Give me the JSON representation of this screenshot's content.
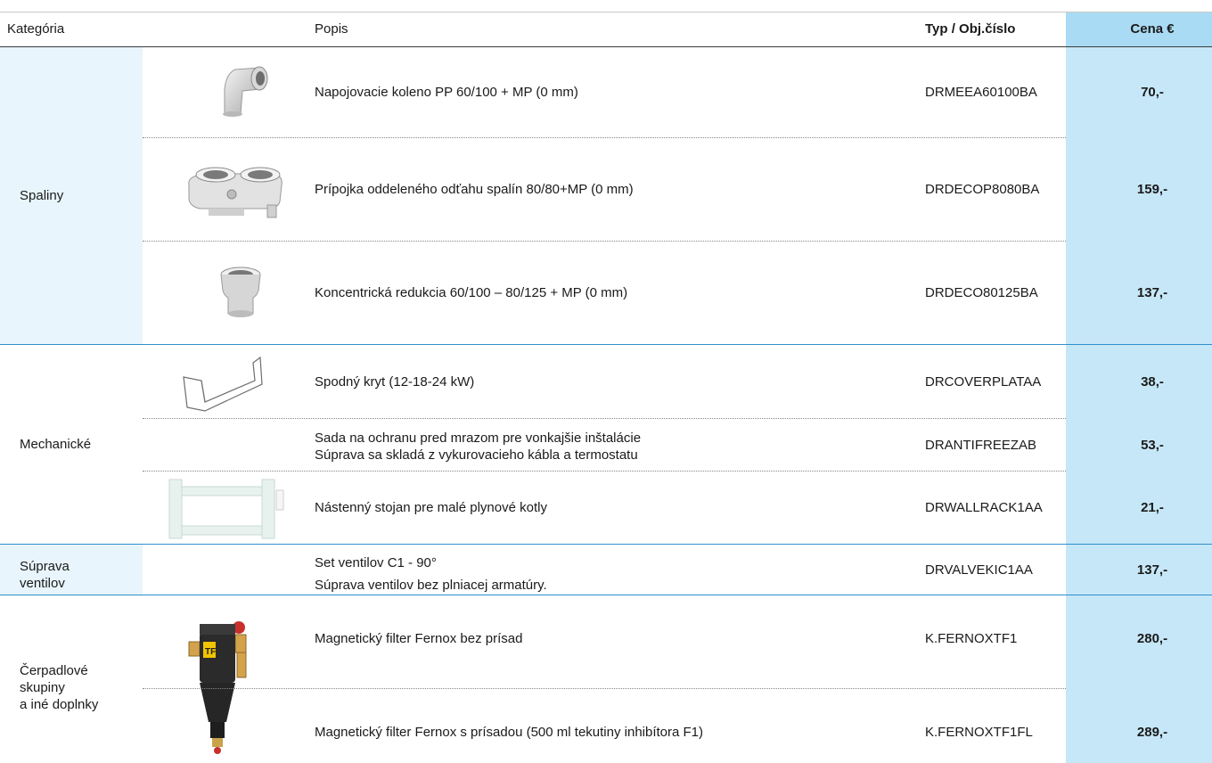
{
  "header": {
    "category": "Kategória",
    "description": "Popis",
    "code": "Typ / Obj.číslo",
    "price": "Cena €"
  },
  "groups": [
    {
      "category": "Spaliny",
      "items": [
        {
          "description": "Napojovacie koleno PP 60/100 + MP (0 mm)",
          "code": "DRMEEA60100BA",
          "price": "70,-",
          "image_icon": "elbow-pipe-icon"
        },
        {
          "description": "Prípojka oddeleného odťahu spalín 80/80+MP (0 mm)",
          "code": "DRDECOP8080BA",
          "price": "159,-",
          "image_icon": "twin-flue-adapter-icon"
        },
        {
          "description": "Koncentrická redukcia 60/100 – 80/125 + MP (0 mm)",
          "code": "DRDECO80125BA",
          "price": "137,-",
          "image_icon": "concentric-reducer-icon"
        }
      ]
    },
    {
      "category": "Mechanické",
      "items": [
        {
          "description": "Spodný kryt (12-18-24 kW)",
          "code": "DRCOVERPLATAA",
          "price": "38,-",
          "image_icon": "cover-plate-icon"
        },
        {
          "description_lines": [
            "Sada na ochranu pred mrazom pre vonkajšie inštalácie",
            "Súprava sa skladá z vykurovacieho kábla a termostatu"
          ],
          "code": "DRANTIFREEZAB",
          "price": "53,-"
        },
        {
          "description": "Nástenný stojan pre malé plynové kotly",
          "code": "DRWALLRACK1AA",
          "price": "21,-",
          "image_icon": "wall-rack-icon"
        }
      ]
    },
    {
      "category_lines": [
        "Súprava",
        "ventilov"
      ],
      "items": [
        {
          "description_lines": [
            "Set ventilov C1 - 90°",
            "Súprava ventilov bez plniacej armatúry."
          ],
          "code": "DRVALVEKIC1AA",
          "price": "137,-"
        }
      ]
    },
    {
      "category_lines": [
        "Čerpadlové",
        "skupiny",
        "a iné doplnky"
      ],
      "items": [
        {
          "description": "Magnetický filter Fernox bez prísad",
          "code": "K.FERNOXTF1",
          "price": "280,-",
          "image_icon": "magnetic-filter-icon"
        },
        {
          "description": "Magnetický filter Fernox s prísadou (500 ml tekutiny inhibítora F1)",
          "code": "K.FERNOXTF1FL",
          "price": "289,-"
        }
      ]
    }
  ],
  "colors": {
    "price_column": "#c6e7f8",
    "price_header": "#a9dbf4",
    "category_highlight": "#e8f5fc",
    "group_divider": "#2f8fcb"
  }
}
